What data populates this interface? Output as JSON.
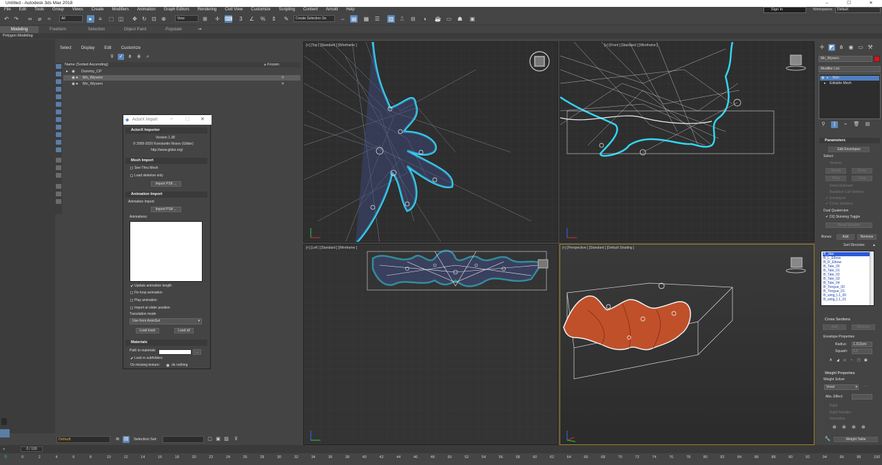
{
  "window": {
    "title": "Untitled - Autodesk 3ds Max 2018"
  },
  "menu": [
    "File",
    "Edit",
    "Tools",
    "Group",
    "Views",
    "Create",
    "Modifiers",
    "Animation",
    "Graph Editors",
    "Rendering",
    "Civil View",
    "Customize",
    "Scripting",
    "Content",
    "Arnold",
    "Help"
  ],
  "account": {
    "signin": "Sign In",
    "workspaces_label": "Workspaces:",
    "workspace": "Default"
  },
  "toolbar": {
    "filter": "All",
    "refcoord": "View",
    "selset": "Create Selection Se"
  },
  "ribbon": {
    "tabs": [
      "Modeling",
      "Freeform",
      "Selection",
      "Object Paint",
      "Populate"
    ],
    "sub": "Polygon Modeling"
  },
  "scene_explorer": {
    "menu": [
      "Select",
      "Display",
      "Edit",
      "Customize"
    ],
    "col_name": "Name (Sorted Ascending)",
    "col_frozen": "Frozen",
    "rows": [
      "Dummy_CP",
      "Mn_Wyvern",
      "Mn_Wyvern"
    ],
    "layer": "Default",
    "selset_label": "Selection Set:"
  },
  "actorx": {
    "title": "ActorX Import",
    "sec_importer": "ActorX Importer",
    "version": "Version 1.38",
    "copyright": "© 2009-2020 Konstantin Nosov (Gildor)",
    "link": "http://www.gildor.org/",
    "sec_mesh": "Mesh Import",
    "see_thru": "See-Thru Mesh",
    "load_skel": "Load skeleton only",
    "import_psk": "Import PSK ...",
    "sec_anim": "Animation Import",
    "anim_import": "Animation Import",
    "import_psa": "Import PSA ...",
    "animations": "Animations:",
    "update_len": "Update animation length",
    "fix_loop": "Fix loop animation",
    "play_anim": "Play animation",
    "import_slider": "Import at slider position",
    "trans_mode": "Translation mode",
    "trans_value": "Use from AnimSet",
    "load_track": "Load track",
    "load_all": "Load all",
    "sec_mat": "Materials",
    "path_mat": "Path to materials",
    "browse": "...",
    "look_sub": "Look in subfolders",
    "missing": "On missing texture:",
    "do_nothing": "do nothing"
  },
  "viewports": {
    "top": "[+] [Top ] [Standard ] [Wireframe ]",
    "front": "[+] [Front ] [Standard ] [Wireframe ]",
    "left": "[+] [Left ] [Standard ] [Wireframe ]",
    "persp": "[+] [Perspective ] [Standard ] [Default Shading ]"
  },
  "command_panel": {
    "object_name": "Mn_Wyvern",
    "modifier_list": "Modifier List",
    "stack": [
      "Skin",
      "Editable Mesh"
    ],
    "parameters": "Parameters",
    "edit_envelopes": "Edit Envelopes",
    "select": "Select",
    "vertices": "Vertices",
    "shrink": "Shrink",
    "grow": "Grow",
    "ring": "Ring",
    "loop": "Loop",
    "select_element": "Select Element",
    "backface": "Backface Cull Vertices",
    "envelopes": "Envelopes",
    "cross_sections": "Cross Sections",
    "dual_quat": "Dual Quaternion",
    "dq_toggle": "DQ Skinning Toggle",
    "blend_weights": "Blend Weights",
    "bones_label": "Bones:",
    "add": "Add",
    "remove": "Remove",
    "sort_dir": "Sort Direction:",
    "bones": [
      "B_Jaw",
      "B_L_Elbow",
      "B_R_Elbow",
      "B_Tale_00",
      "B_Tale_01",
      "B_Tale_02",
      "B_Tale_03",
      "B_Tale_04",
      "B_Tongue_00",
      "B_Tongue_01",
      "B_wing_L1_00",
      "B_wing_L1_01"
    ],
    "cross_sections_sec": "Cross Sections",
    "envelope_props": "Envelope Properties",
    "radius_label": "Radius:",
    "radius": "1.313cm",
    "squash_label": "Squash:",
    "squash": "1.0",
    "weight_props": "Weight Properties",
    "weight_solver": "Weight Solver",
    "solver": "Voxel",
    "abs_effect": "Abs. Effect:",
    "rigid": "Rigid",
    "rigid_handles": "Rigid Handles",
    "normalize": "Normalize",
    "weight_table": "Weight Table"
  },
  "timeline": {
    "slider": "0 / 100",
    "ticks": [
      "0",
      "2",
      "4",
      "6",
      "8",
      "10",
      "12",
      "14",
      "16",
      "18",
      "20",
      "22",
      "24",
      "26",
      "28",
      "30",
      "32",
      "34",
      "36",
      "38",
      "40",
      "42",
      "44",
      "46",
      "48",
      "50",
      "52",
      "54",
      "56",
      "58",
      "60",
      "62",
      "64",
      "66",
      "68",
      "70",
      "72",
      "74",
      "76",
      "78",
      "80",
      "82",
      "84",
      "86",
      "88",
      "90",
      "92",
      "94",
      "96",
      "98",
      "100"
    ]
  }
}
